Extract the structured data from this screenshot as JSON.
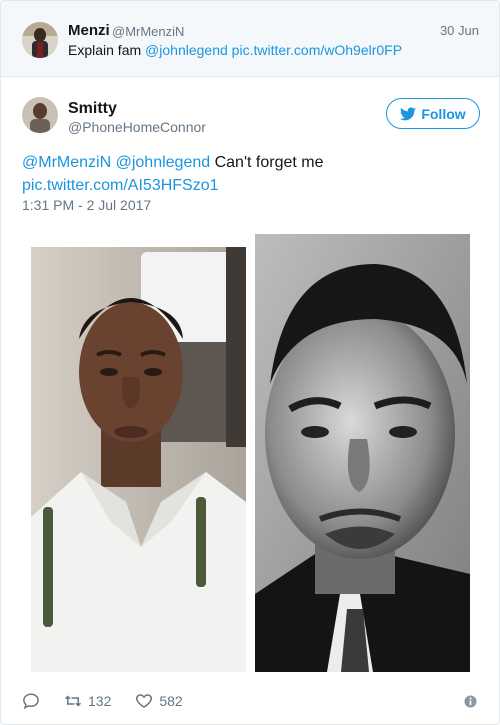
{
  "parent_tweet": {
    "name": "Menzi",
    "handle": "@MrMenziN",
    "date": "30 Jun",
    "text_plain": "Explain fam ",
    "mention": "@johnlegend",
    "pic_link": "pic.twitter.com/wOh9elr0FP"
  },
  "tweet": {
    "name": "Smitty",
    "handle": "@PhoneHomeConnor",
    "follow_label": "Follow",
    "mention_1": "@MrMenziN",
    "mention_2": "@johnlegend",
    "text_plain": "Can't forget me",
    "pic_link": "pic.twitter.com/AI53HFSzo1",
    "timestamp": "1:31 PM - 2 Jul 2017"
  },
  "stats": {
    "retweets": "132",
    "likes": "582"
  },
  "colors": {
    "accent": "#1b95e0",
    "muted": "#657786",
    "text": "#14171a",
    "border": "#e1e8ed",
    "parent_bg": "#f5f8fa"
  },
  "icons": {
    "bird": "twitter-bird-icon",
    "reply": "reply-icon",
    "retweet": "retweet-icon",
    "like": "heart-icon",
    "info": "info-icon"
  }
}
